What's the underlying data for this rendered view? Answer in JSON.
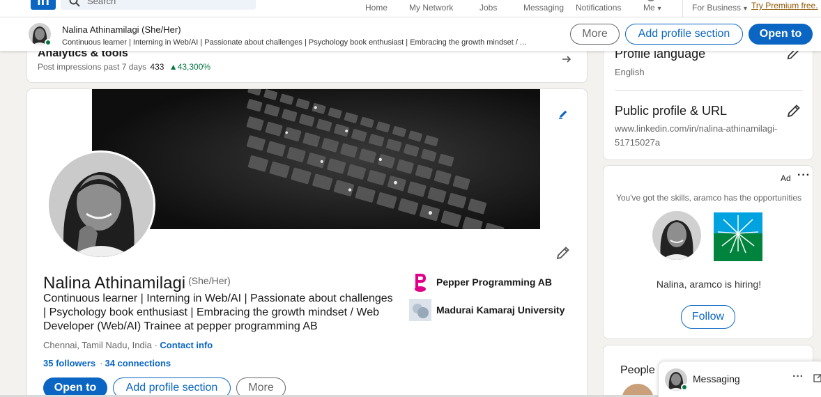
{
  "nav": {
    "logo": "in",
    "search_placeholder": "Search",
    "items": [
      "Home",
      "My Network",
      "Jobs",
      "Messaging",
      "Notifications",
      "Me"
    ],
    "business": "For Business",
    "premium": "Try Premium free."
  },
  "sticky": {
    "name": "Nalina Athinamilagi (She/Her)",
    "headline": "Continuous learner | Interning in Web/AI | Passionate about challenges | Psychology book enthusiast | Embracing the growth mindset / ...",
    "more": "More",
    "add_section": "Add profile section",
    "open_to": "Open to"
  },
  "analytics": {
    "title": "Analytics & tools",
    "label": "Post impressions past 7 days",
    "impressions": "433",
    "change": "43,300%"
  },
  "profile": {
    "name": "Nalina Athinamilagi",
    "pronouns": "(She/Her)",
    "headline": "Continuous learner | Interning in Web/AI | Passionate about challenges | Psychology book enthusiast | Embracing the growth mindset / Web Developer (Web/AI) Trainee at pepper programming AB",
    "location": "Chennai, Tamil Nadu, India",
    "contact": "Contact info",
    "followers": "35 followers",
    "connections": "34 connections",
    "open_to": "Open to",
    "add_section": "Add profile section",
    "more": "More",
    "orgs": [
      "Pepper Programming AB",
      "Madurai Kamaraj University"
    ]
  },
  "side": {
    "language_title": "Profile language",
    "language": "English",
    "url_title": "Public profile & URL",
    "url": "www.linkedin.com/in/nalina-athinamilagi-51715027a"
  },
  "ad": {
    "label": "Ad",
    "tagline": "You've got the skills, aramco has the opportunities",
    "message": "Nalina, aramco is hiring!",
    "follow": "Follow"
  },
  "people": {
    "title": "People"
  },
  "messaging": {
    "title": "Messaging"
  },
  "colors": {
    "brand": "#0a66c2",
    "positive": "#057642",
    "premium": "#915907"
  }
}
